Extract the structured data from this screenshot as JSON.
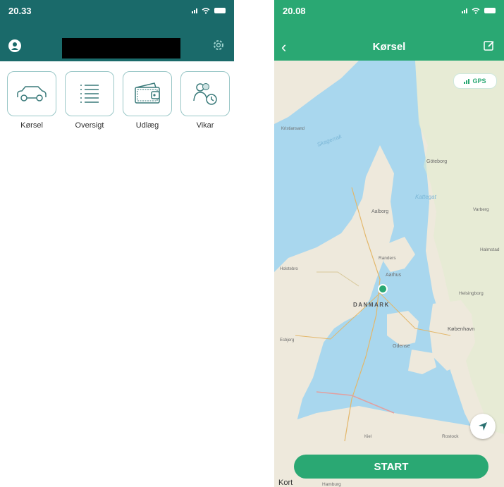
{
  "left": {
    "status_time": "20.33",
    "tiles": [
      {
        "label": "Kørsel",
        "icon": "car-icon"
      },
      {
        "label": "Oversigt",
        "icon": "list-icon"
      },
      {
        "label": "Udlæg",
        "icon": "wallet-icon"
      },
      {
        "label": "Vikar",
        "icon": "people-clock-icon"
      }
    ]
  },
  "right": {
    "status_time": "20.08",
    "title": "Kørsel",
    "gps_label": "GPS",
    "map": {
      "labels": {
        "skagerrak": "Skagerrak",
        "kattegat": "Kattegat",
        "goteborg": "Göteborg",
        "varberg": "Varberg",
        "halmstad": "Halmstad",
        "helsingborg": "Helsingborg",
        "kobenhavn": "København",
        "aalborg": "Aalborg",
        "randers": "Randers",
        "aarhus": "Aarhus",
        "danmark": "DANMARK",
        "odense": "Odense",
        "esbjerg": "Esbjerg",
        "holstebro": "Holstebro",
        "kristiansand": "Kristiansand",
        "kiel": "Kiel",
        "rostock": "Rostock",
        "hamburg": "Hamburg"
      }
    },
    "start_label": "START",
    "map_attribution": "Kort"
  },
  "colors": {
    "left_header": "#1a6a6a",
    "accent_green": "#2aa873",
    "sea": "#a9d7ee",
    "land": "#eee9dc"
  }
}
